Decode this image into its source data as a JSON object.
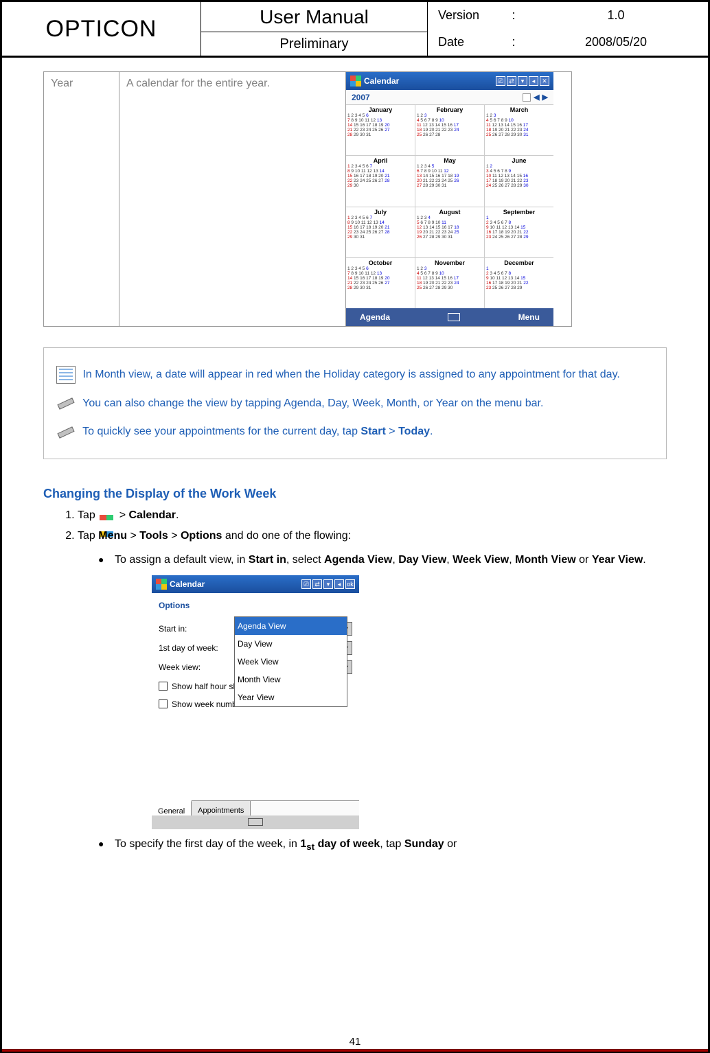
{
  "header": {
    "brand": "OPTICON",
    "title": "User Manual",
    "subtitle": "Preliminary",
    "meta": [
      {
        "label": "Version",
        "colon": ":",
        "value": "1.0"
      },
      {
        "label": "Date",
        "colon": ":",
        "value": "2008/05/20"
      }
    ]
  },
  "table_row": {
    "col1": "Year",
    "col2": "A calendar for the entire year."
  },
  "calendar_screenshot": {
    "titlebar_text": "Calendar",
    "year": "2007",
    "months": [
      "January",
      "February",
      "March",
      "April",
      "May",
      "June",
      "July",
      "August",
      "September",
      "October",
      "November",
      "December"
    ],
    "bottombar_left": "Agenda",
    "bottombar_right": "Menu",
    "nav_left": "◀",
    "nav_right": "▶",
    "tray_close": "✕"
  },
  "tips": {
    "note1_pre": "In Month view, a date will appear in red when the Holiday category is assigned to any appointment for that day.",
    "note2": "You can also change the view by tapping Agenda, Day, Week, Month, or Year on the menu bar.",
    "note3_pre": "To quickly see your appointments for the current day, tap ",
    "note3_b1": "Start",
    "note3_mid": " > ",
    "note3_b2": "Today",
    "note3_end": "."
  },
  "section": {
    "title": "Changing the Display of the Work Week",
    "step1_pre": "Tap ",
    "step1_mid": "  > ",
    "step1_b": "Calendar",
    "step1_end": ".",
    "step2_pre": "Tap ",
    "step2_b1": "Menu",
    "step2_m1": " > ",
    "step2_b2": "Tools",
    "step2_m2": " > ",
    "step2_b3": "Options",
    "step2_end": " and do one of the flowing:",
    "sub1_pre": "To assign a default view, in ",
    "sub1_b1": "Start in",
    "sub1_m1": ", select ",
    "sub1_b2": "Agenda View",
    "sub1_m2": ", ",
    "sub1_b3": "Day View",
    "sub1_m3": ", ",
    "sub1_b4": "Week View",
    "sub1_m4": ", ",
    "sub1_b5": "Month View",
    "sub1_m5": " or ",
    "sub1_b6": "Year View",
    "sub1_end": ".",
    "sub2_pre": "To specify the first day of the week, in ",
    "sub2_b1": "1",
    "sub2_sub": "st",
    "sub2_b1b": " day of week",
    "sub2_m": ", tap ",
    "sub2_b2": "Sunday",
    "sub2_end": " or"
  },
  "options_screenshot": {
    "titlebar_text": "Calendar",
    "tray_ok": "ok",
    "heading": "Options",
    "row_startin_label": "Start in:",
    "row_startin_value": "Agenda View",
    "row_firstday_label": "1st day of week:",
    "row_weekview_label": "Week view:",
    "check1": "Show half hour slots",
    "check2": "Show week numbers",
    "dropdown": [
      "Agenda View",
      "Day View",
      "Week View",
      "Month View",
      "Year View"
    ],
    "dropdown_selected_index": 0,
    "tabs": [
      "General",
      "Appointments"
    ],
    "active_tab_index": 0
  },
  "page_number": "41"
}
